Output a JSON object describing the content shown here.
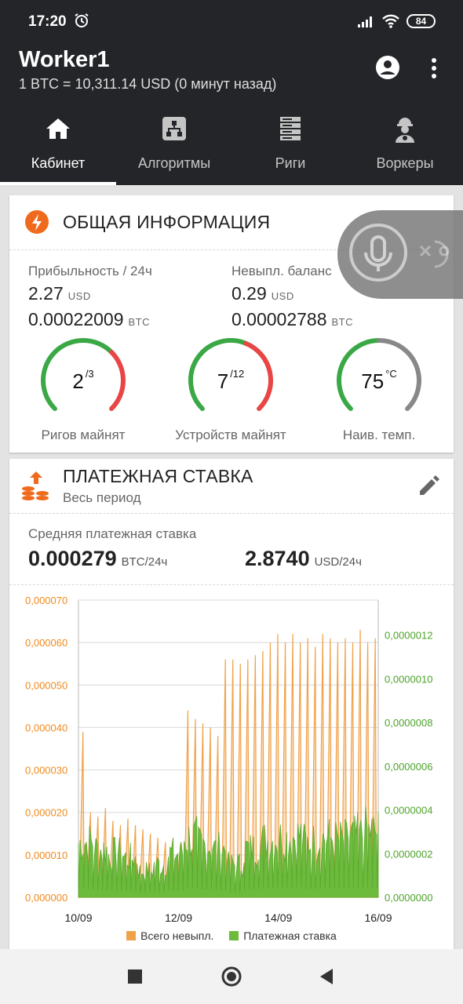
{
  "status_bar": {
    "time": "17:20",
    "battery": "84"
  },
  "app_bar": {
    "title": "Worker1",
    "subtitle": "1 BTC = 10,311.14 USD (0 минут назад)"
  },
  "tabs": [
    {
      "label": "Кабинет",
      "icon": "home-icon"
    },
    {
      "label": "Алгоритмы",
      "icon": "algorithm-icon"
    },
    {
      "label": "Риги",
      "icon": "server-rack-icon"
    },
    {
      "label": "Воркеры",
      "icon": "worker-icon"
    }
  ],
  "general": {
    "title": "ОБЩАЯ ИНФОРМАЦИЯ",
    "profit_label": "Прибыльность / 24ч",
    "profit_usd": "2.27",
    "profit_btc": "0.00022009",
    "balance_label": "Невыпл. баланс",
    "balance_usd": "0.29",
    "balance_btc": "0.00002788",
    "usd": "USD",
    "btc": "BTC",
    "gauges": [
      {
        "value": "2",
        "suffix": "/3",
        "label": "Ригов майнят",
        "fraction": 0.667,
        "color": "#e84545"
      },
      {
        "value": "7",
        "suffix": "/12",
        "label": "Устройств майнят",
        "fraction": 0.583,
        "color": "#e84545"
      },
      {
        "value": "75",
        "suffix": "°C",
        "label": "Наив. темп.",
        "fraction": 0.5,
        "color": "#888888"
      }
    ]
  },
  "payment": {
    "title": "ПЛАТЕЖНАЯ СТАВКА",
    "subtitle": "Весь период",
    "avg_label": "Средняя платежная ставка",
    "avg_btc": "0.000279",
    "avg_btc_unit": "BTC/24ч",
    "avg_usd": "2.8740",
    "avg_usd_unit": "USD/24ч"
  },
  "chart_data": {
    "type": "area",
    "x_ticks": [
      "10/09",
      "12/09",
      "14/09",
      "16/09"
    ],
    "y_left_ticks": [
      "0,000000",
      "0,000010",
      "0,000020",
      "0,000030",
      "0,000040",
      "0,000050",
      "0,000060",
      "0,000070"
    ],
    "y_left_range": [
      0,
      7e-05
    ],
    "y_right_ticks": [
      "0,0000000",
      "0,0000002",
      "0,0000004",
      "0,0000006",
      "0,0000008",
      "0,0000010",
      "0,0000012"
    ],
    "y_right_range": [
      0,
      1.36e-06
    ],
    "series": [
      {
        "name": "Всего невыпл.",
        "axis": "left",
        "color": "#f0a24a",
        "peaks": [
          3.9e-05,
          2e-05,
          1.9e-05,
          2.1e-05,
          1.8e-05,
          1.7e-05,
          1.85e-05,
          1.7e-05,
          1.6e-05,
          1.5e-05,
          1.4e-05,
          1.3e-05,
          1.2e-05,
          1.25e-05,
          4.4e-05,
          4.2e-05,
          4.1e-05,
          4e-05,
          3.8e-05,
          5.6e-05,
          5.6e-05,
          5.5e-05,
          5.6e-05,
          5.7e-05,
          5.8e-05,
          6e-05,
          6.2e-05,
          6e-05,
          6.2e-05,
          6e-05,
          6.1e-05,
          5.9e-05,
          6.2e-05,
          6.1e-05,
          6e-05,
          6.1e-05,
          6e-05,
          6.3e-05,
          6e-05,
          6.1e-05
        ]
      },
      {
        "name": "Платежная ставка",
        "axis": "right",
        "color": "#6cbb3c",
        "levels": [
          2.5e-07,
          2.2e-07,
          2e-07,
          1.8e-07,
          1.2e-07,
          1.5e-07,
          2e-07,
          2.7e-07,
          2.4e-07,
          2.2e-07,
          1.5e-07,
          2.2e-07,
          2.6e-07,
          2.7e-07,
          2.8e-07,
          2.5e-07,
          2.7e-07,
          2.6e-07,
          2.8e-07,
          3e-07
        ]
      }
    ]
  }
}
